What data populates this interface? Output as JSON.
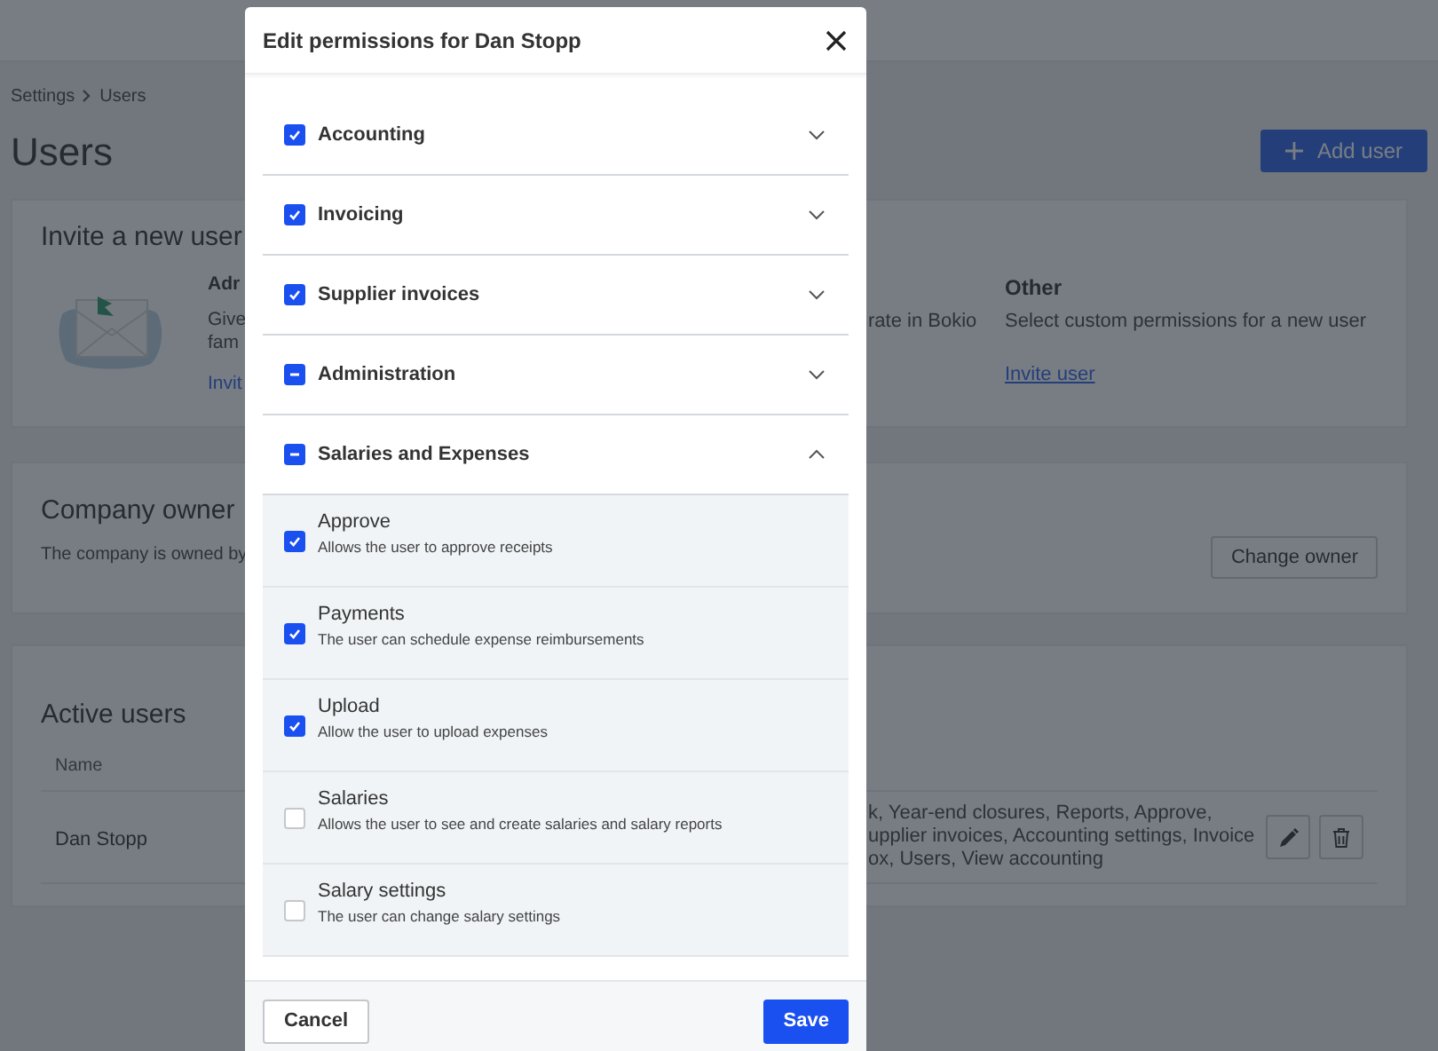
{
  "breadcrumb": [
    "Settings",
    "Users"
  ],
  "page_title": "Users",
  "add_user_button": "Add user",
  "invite_card": {
    "title": "Invite a new user",
    "left_option": {
      "heading": "Adr",
      "lines": [
        "Give",
        "fam"
      ],
      "link": "Invit"
    },
    "middle_fragment": "rate in Bokio",
    "other_option": {
      "heading": "Other",
      "description": "Select custom permissions for a new user",
      "link": "Invite user"
    }
  },
  "owner_card": {
    "title": "Company owner",
    "description": "The company is owned by",
    "button": "Change owner"
  },
  "users_card": {
    "title": "Active users",
    "columns": [
      "Name"
    ],
    "rows": [
      {
        "name": "Dan Stopp",
        "permissions": [
          "k, Year-end closures, Reports, Approve,",
          "upplier invoices, Accounting settings, Invoice",
          "ox, Users, View accounting"
        ]
      }
    ]
  },
  "dialog": {
    "title": "Edit permissions for Dan Stopp",
    "groups": [
      {
        "label": "Accounting",
        "checked": true,
        "expanded": false
      },
      {
        "label": "Invoicing",
        "checked": true,
        "expanded": false
      },
      {
        "label": "Supplier invoices",
        "checked": true,
        "expanded": false
      },
      {
        "label": "Administration",
        "partial": true,
        "expanded": false
      },
      {
        "label": "Salaries and Expenses",
        "partial": true,
        "expanded": true,
        "children": [
          {
            "label": "Approve",
            "description": "Allows the user to approve receipts",
            "checked": true
          },
          {
            "label": "Payments",
            "description": "The user can schedule expense reimbursements",
            "checked": true
          },
          {
            "label": "Upload",
            "description": "Allow the user to upload expenses",
            "checked": true
          },
          {
            "label": "Salaries",
            "description": "Allows the user to see and create salaries and salary reports",
            "checked": false
          },
          {
            "label": "Salary settings",
            "description": "The user can change salary settings",
            "checked": false
          }
        ]
      }
    ],
    "cancel_button": "Cancel",
    "save_button": "Save"
  }
}
